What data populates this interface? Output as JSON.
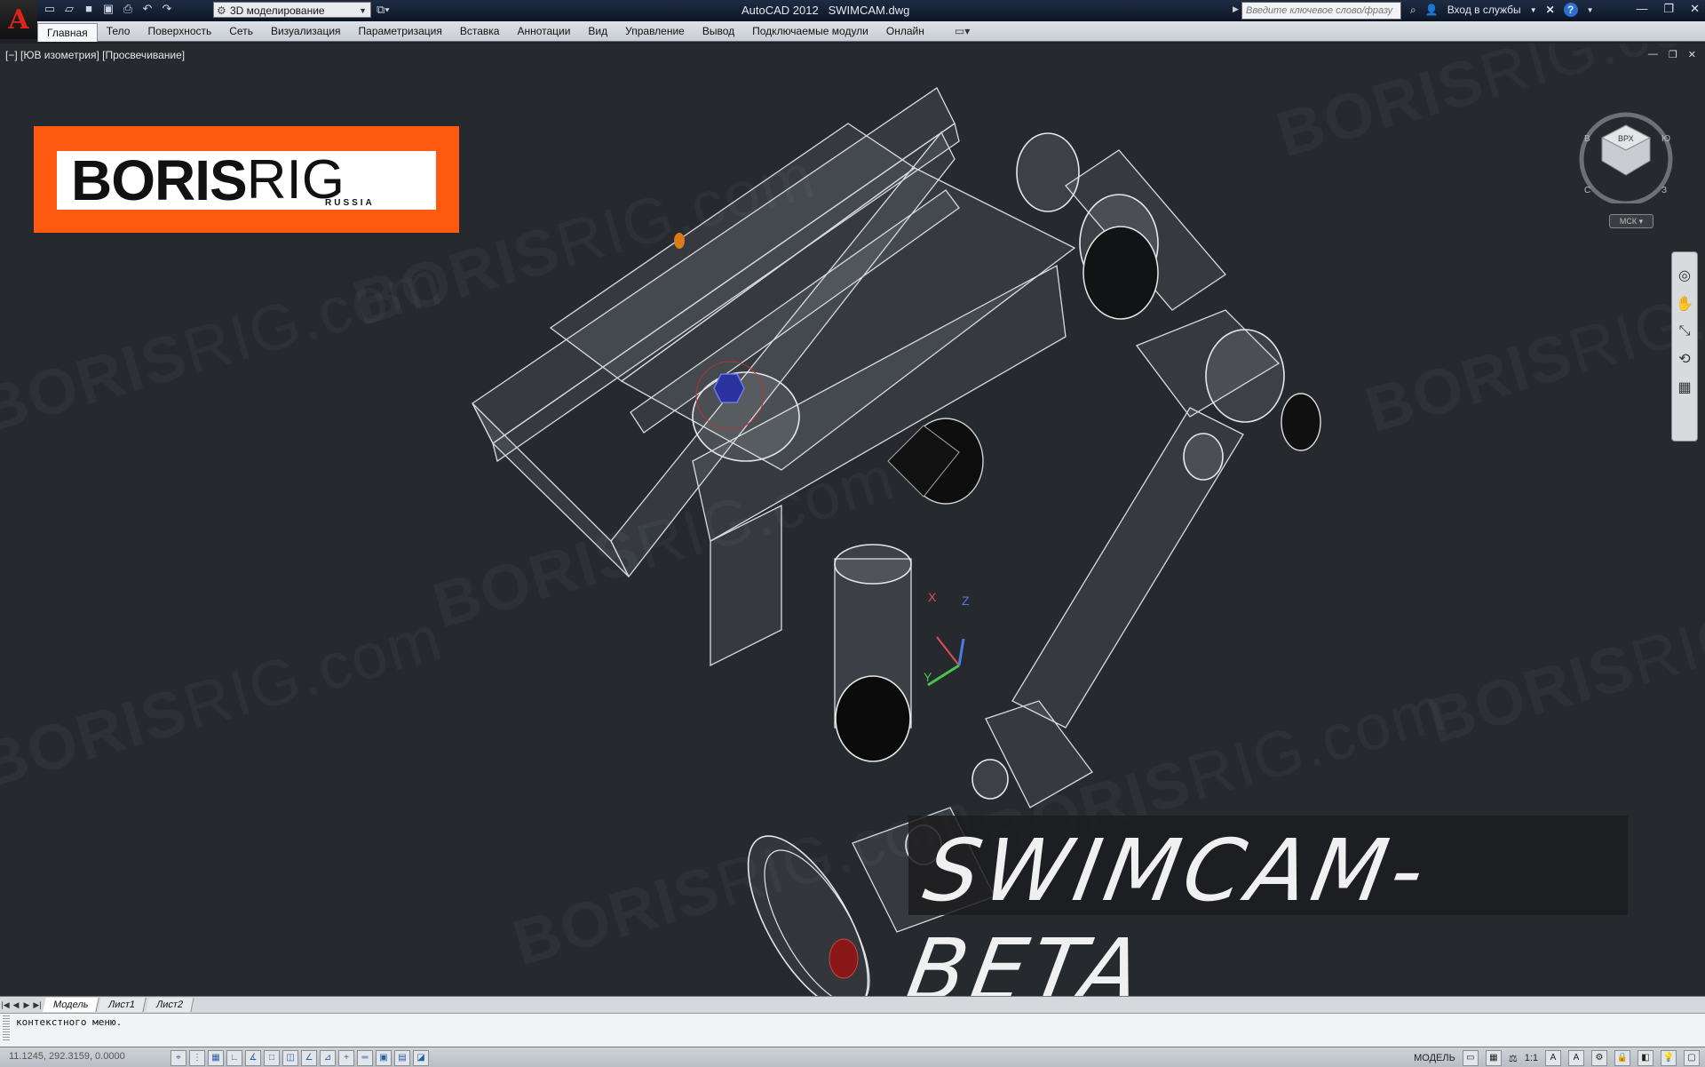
{
  "app": {
    "title": "AutoCAD 2012",
    "file": "SWIMCAM.dwg",
    "logo_letter": "A"
  },
  "quick_access": {
    "workspace": "3D моделирование"
  },
  "search": {
    "placeholder": "Введите ключевое слово/фразу"
  },
  "account": {
    "signin": "Вход в службы"
  },
  "ribbon_tabs": [
    "Главная",
    "Тело",
    "Поверхность",
    "Сеть",
    "Визуализация",
    "Параметризация",
    "Вставка",
    "Аннотации",
    "Вид",
    "Управление",
    "Вывод",
    "Подключаемые модули",
    "Онлайн"
  ],
  "viewport": {
    "label": "[−] [ЮВ изометрия] [Просвечивание]",
    "ucs_button": "МСК",
    "ucs_axes": {
      "x": "X",
      "y": "Y",
      "z": "Z"
    }
  },
  "overlay": {
    "logo_bold": "BORIS",
    "logo_light": "RIG",
    "logo_sub": "RUSSIA",
    "banner": "SWIMCAM-BETA",
    "watermark_bold": "BORIS",
    "watermark_light": "RIG.com"
  },
  "layout_tabs": [
    "Модель",
    "Лист1",
    "Лист2"
  ],
  "command_line": {
    "text": "контекстного меню."
  },
  "status": {
    "coords": "11.1245, 292.3159, 0.0000",
    "model_label": "МОДЕЛЬ",
    "scale": "1:1"
  },
  "colors": {
    "accent": "#ff5a12",
    "viewport_bg": "#262a2f",
    "autocad_red": "#e0231a"
  }
}
